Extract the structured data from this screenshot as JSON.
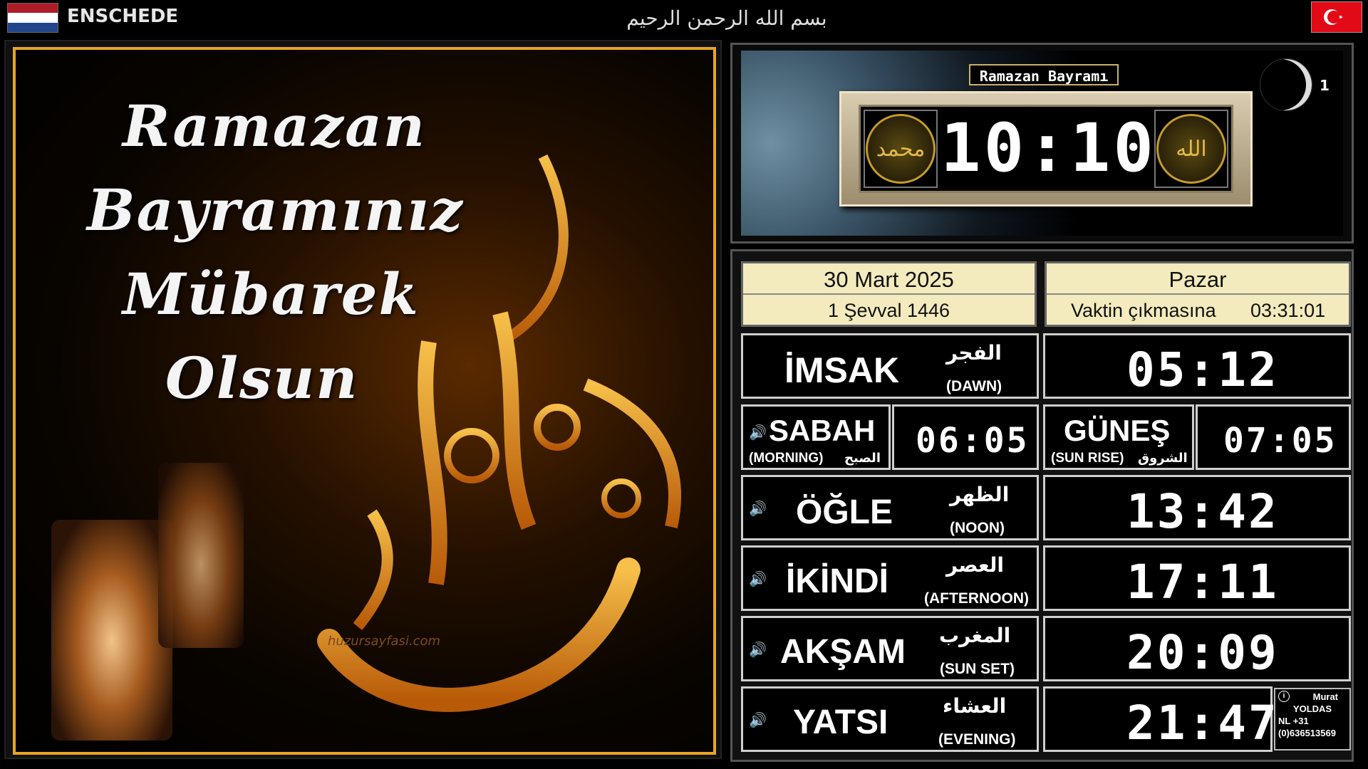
{
  "header": {
    "city": "ENSCHEDE",
    "basmala": "بسم الله الرحمن الرحيم",
    "left_flag": "netherlands-flag",
    "right_flag": "turkey-flag"
  },
  "poster": {
    "lines": [
      "Ramazan",
      "Bayramınız",
      "Mübarek",
      "Olsun"
    ],
    "calligraphy": "عيد مبارك",
    "watermark": "huzursayfasi.com"
  },
  "clock": {
    "event": "Ramazan Bayramı",
    "time": "10:10",
    "left_medallion": "محمد",
    "right_medallion": "الله",
    "moon_day": "1"
  },
  "date": {
    "gregorian": "30 Mart 2025",
    "hijri": "1 Şevval 1446",
    "weekday": "Pazar",
    "countdown_label": "Vaktin çıkmasına",
    "countdown": "03:31:01"
  },
  "prayers": {
    "imsak": {
      "name": "İMSAK",
      "arabic": "الفجر",
      "english": "(DAWN)",
      "time": "05:12"
    },
    "sabah": {
      "name": "SABAH",
      "arabic": "الصبح",
      "english": "(MORNING)",
      "time": "06:05"
    },
    "gunes": {
      "name": "GÜNEŞ",
      "arabic": "الشروق",
      "english": "(SUN RISE)",
      "time": "07:05"
    },
    "ogle": {
      "name": "ÖĞLE",
      "arabic": "الظهر",
      "english": "(NOON)",
      "time": "13:42"
    },
    "ikindi": {
      "name": "İKİNDİ",
      "arabic": "العصر",
      "english": "(AFTERNOON)",
      "time": "17:11"
    },
    "aksam": {
      "name": "AKŞAM",
      "arabic": "المغرب",
      "english": "(SUN SET)",
      "time": "20:09"
    },
    "yatsi": {
      "name": "YATSI",
      "arabic": "العشاء",
      "english": "(EVENING)",
      "time": "21:47"
    }
  },
  "credit": {
    "line1": "Murat",
    "line2": "YOLDAS",
    "line3": "NL +31",
    "line4": "(0)636513569"
  },
  "colors": {
    "date_bg": "#f3ebbd",
    "gold": "#e8a423",
    "turkey_red": "#e30a17"
  }
}
